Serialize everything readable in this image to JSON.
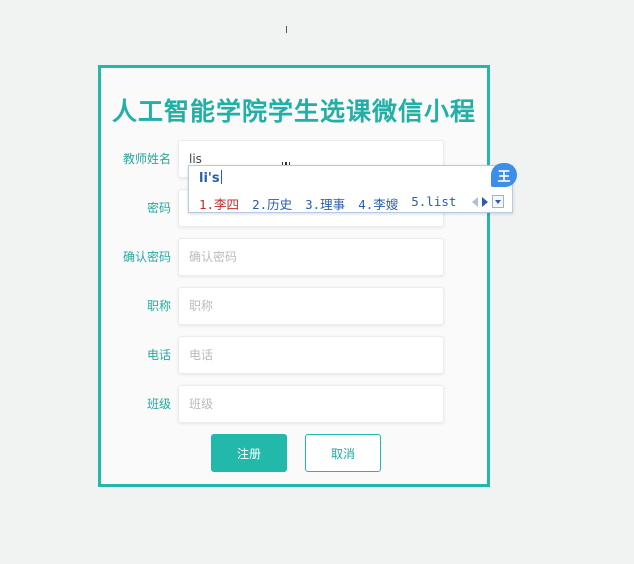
{
  "page": {
    "title": "人工智能学院学生选课微信小程"
  },
  "form": {
    "fields": [
      {
        "label": "教师姓名",
        "value": "lis",
        "placeholder": ""
      },
      {
        "label": "密码",
        "value": "",
        "placeholder": ""
      },
      {
        "label": "确认密码",
        "value": "",
        "placeholder": "确认密码"
      },
      {
        "label": "职称",
        "value": "",
        "placeholder": "职称"
      },
      {
        "label": "电话",
        "value": "",
        "placeholder": "电话"
      },
      {
        "label": "班级",
        "value": "",
        "placeholder": "班级"
      }
    ],
    "submit_label": "注册",
    "cancel_label": "取消"
  },
  "ime": {
    "pinyin": "li's",
    "candidates": [
      "1.李四",
      "2.历史",
      "3.理事",
      "4.李嫂",
      "5.list"
    ],
    "logo_text": "王",
    "icons": [
      "prev-page-icon",
      "next-page-icon",
      "expand-icon",
      "ime-logo-icon"
    ]
  },
  "colors": {
    "accent": "#22b8aa",
    "background": "#f1f2f2",
    "ime_text": "#2a5db0",
    "ime_selected": "#c62828"
  }
}
